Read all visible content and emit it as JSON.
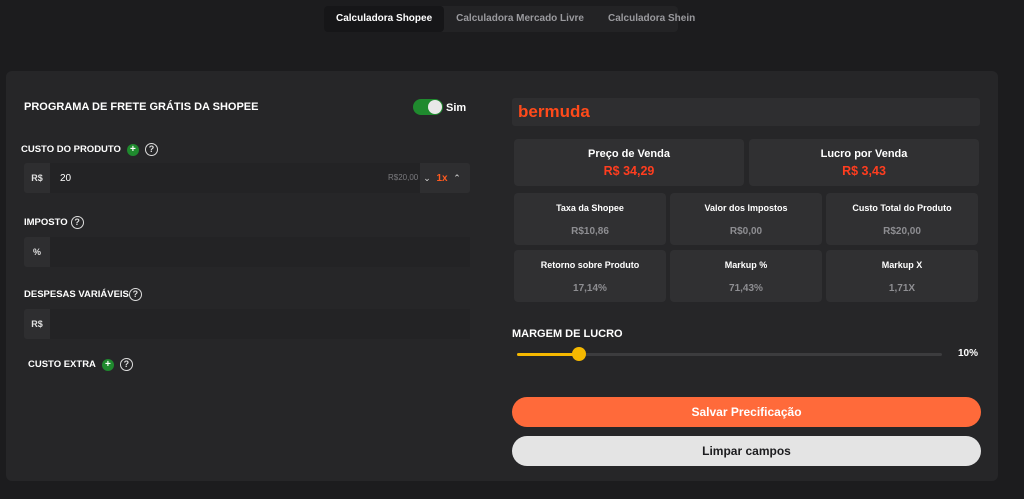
{
  "tabs": [
    {
      "label": "Calculadora Shopee",
      "active": true
    },
    {
      "label": "Calculadora Mercado Livre",
      "active": false
    },
    {
      "label": "Calculadora Shein",
      "active": false
    }
  ],
  "freight": {
    "title": "PROGRAMA DE FRETE GRÁTIS DA SHOPEE",
    "toggle_label": "Sim",
    "enabled": true
  },
  "product_cost": {
    "label": "CUSTO DO PRODUTO",
    "prefix": "R$",
    "value": "20",
    "hint": "R$20,00",
    "multiplier": "1x"
  },
  "tax": {
    "label": "IMPOSTO",
    "prefix": "%",
    "value": ""
  },
  "variable_expenses": {
    "label": "DESPESAS VARIÁVEIS",
    "prefix": "R$",
    "value": ""
  },
  "extra_cost": {
    "label": "CUSTO EXTRA"
  },
  "product_name": "bermuda",
  "summary": {
    "sale_price": {
      "label": "Preço de Venda",
      "value": "R$ 34,29"
    },
    "profit": {
      "label": "Lucro por Venda",
      "value": "R$ 3,43"
    }
  },
  "metrics": [
    {
      "label": "Taxa da Shopee",
      "value": "R$10,86"
    },
    {
      "label": "Valor dos Impostos",
      "value": "R$0,00"
    },
    {
      "label": "Custo Total do Produto",
      "value": "R$20,00"
    },
    {
      "label": "Retorno sobre Produto",
      "value": "17,14%"
    },
    {
      "label": "Markup %",
      "value": "71,43%"
    },
    {
      "label": "Markup X",
      "value": "1,71X"
    }
  ],
  "margin": {
    "title": "MARGEM DE LUCRO",
    "display": "10%",
    "fraction": 0.145
  },
  "buttons": {
    "save": "Salvar Precificação",
    "clear": "Limpar campos"
  },
  "colors": {
    "accent": "#ff6a3a",
    "result": "#ff3d1f",
    "toggle": "#1f8a2e",
    "slider": "#f5b800"
  }
}
